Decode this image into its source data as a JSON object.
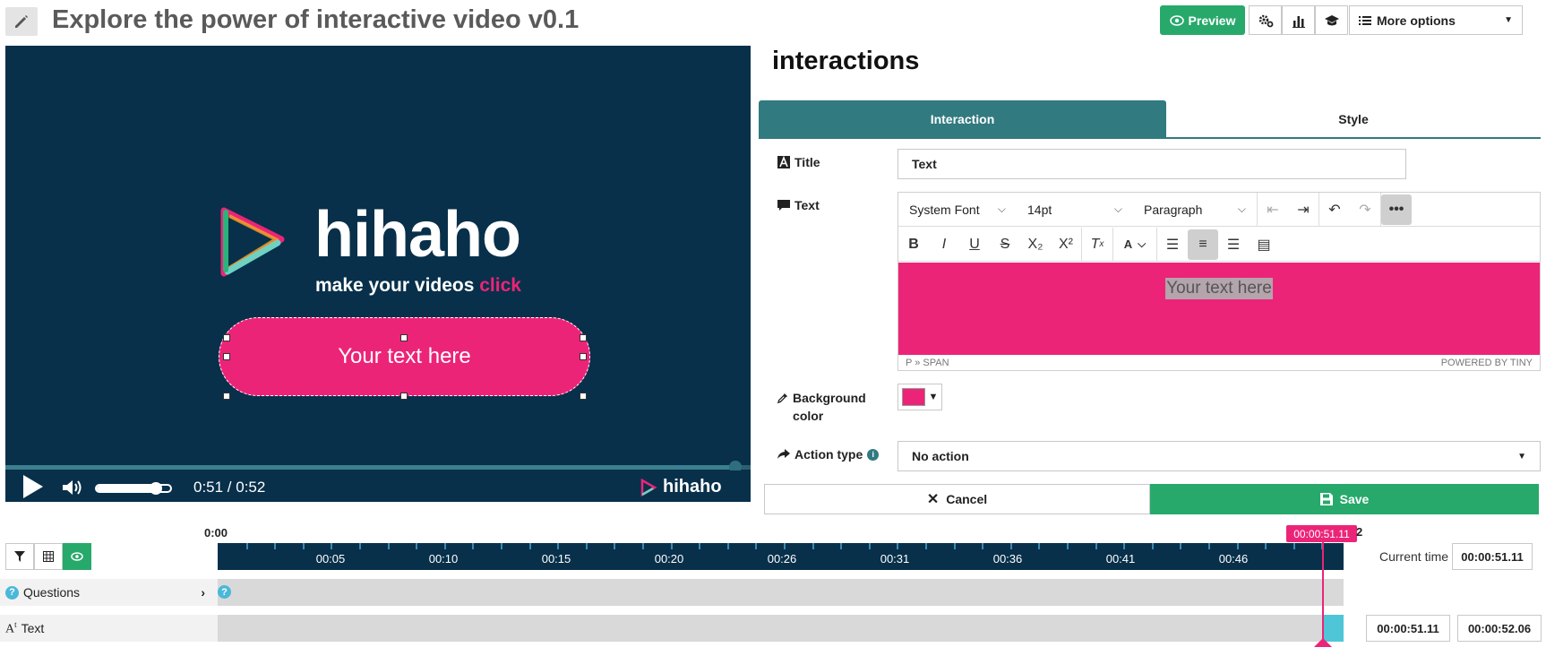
{
  "header": {
    "title": "Explore the power of interactive video v0.1",
    "preview_label": "Preview",
    "more_options_label": "More options",
    "tool_icons": [
      "settings-icon",
      "stats-icon",
      "graduation-icon"
    ]
  },
  "video": {
    "overlay_text": "Your text here",
    "brand_word": "hihaho",
    "brand_tag_prefix": "make your videos ",
    "brand_tag_highlight": "click",
    "time": "0:51 / 0:52",
    "progress": 0.98,
    "volume": 0.8,
    "corner_logo": "hihaho"
  },
  "panel": {
    "heading": "interactions",
    "tabs": {
      "interaction": "Interaction",
      "style": "Style"
    },
    "title_label": "Title",
    "title_value": "Text",
    "text_label": "Text",
    "editor": {
      "font": "System Font",
      "size": "14pt",
      "block": "Paragraph",
      "body_text": "Your text here",
      "path": "P » SPAN",
      "powered": "POWERED BY TINY"
    },
    "bg_label": "Background color",
    "bg_color": "#ec2478",
    "action_label": "Action type",
    "action_value": "No action",
    "cancel_label": "Cancel",
    "save_label": "Save"
  },
  "timeline": {
    "start_label": "0:00",
    "tick_labels": [
      "00:05",
      "00:10",
      "00:15",
      "00:20",
      "00:26",
      "00:31",
      "00:36",
      "00:41",
      "00:46"
    ],
    "playhead": "00:00:51.11",
    "current_time_label": "Current time",
    "current_time": "00:00:51.11",
    "rows": [
      {
        "label": "Questions"
      },
      {
        "label": "Text"
      }
    ],
    "text_start": "00:00:51.11",
    "text_end": "00:00:52.06"
  }
}
